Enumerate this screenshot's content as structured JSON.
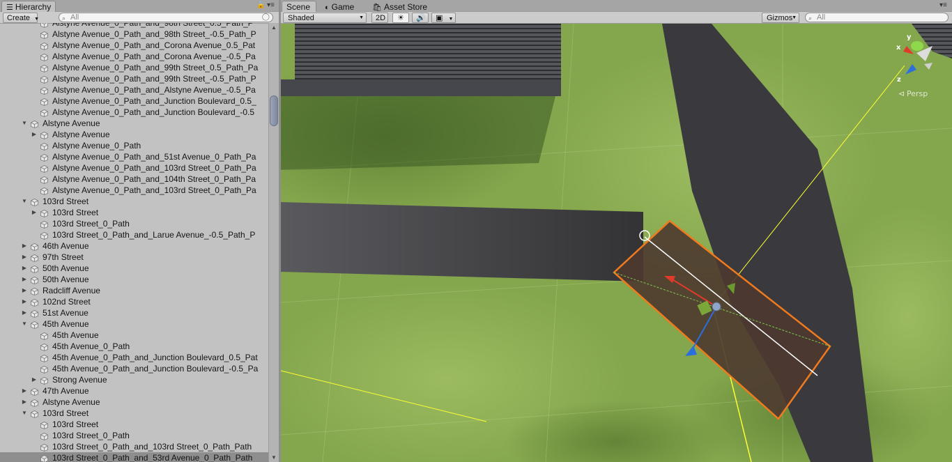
{
  "hierarchy": {
    "tab_label": "Hierarchy",
    "create_label": "Create",
    "search_placeholder": "All",
    "rows": [
      {
        "label": "Alstyne Avenue_0_Path_and_98th Street_0.5_Path_P",
        "depth": 2,
        "arrow": ""
      },
      {
        "label": "Alstyne Avenue_0_Path_and_98th Street_-0.5_Path_P",
        "depth": 2,
        "arrow": ""
      },
      {
        "label": "Alstyne Avenue_0_Path_and_Corona Avenue_0.5_Pat",
        "depth": 2,
        "arrow": ""
      },
      {
        "label": "Alstyne Avenue_0_Path_and_Corona Avenue_-0.5_Pa",
        "depth": 2,
        "arrow": ""
      },
      {
        "label": "Alstyne Avenue_0_Path_and_99th Street_0.5_Path_Pa",
        "depth": 2,
        "arrow": ""
      },
      {
        "label": "Alstyne Avenue_0_Path_and_99th Street_-0.5_Path_P",
        "depth": 2,
        "arrow": ""
      },
      {
        "label": "Alstyne Avenue_0_Path_and_Alstyne Avenue_-0.5_Pa",
        "depth": 2,
        "arrow": ""
      },
      {
        "label": "Alstyne Avenue_0_Path_and_Junction Boulevard_0.5_",
        "depth": 2,
        "arrow": ""
      },
      {
        "label": "Alstyne Avenue_0_Path_and_Junction Boulevard_-0.5",
        "depth": 2,
        "arrow": ""
      },
      {
        "label": "Alstyne Avenue",
        "depth": 1,
        "arrow": "open"
      },
      {
        "label": "Alstyne Avenue",
        "depth": 2,
        "arrow": "closed"
      },
      {
        "label": "Alstyne Avenue_0_Path",
        "depth": 2,
        "arrow": ""
      },
      {
        "label": "Alstyne Avenue_0_Path_and_51st Avenue_0_Path_Pa",
        "depth": 2,
        "arrow": ""
      },
      {
        "label": "Alstyne Avenue_0_Path_and_103rd Street_0_Path_Pa",
        "depth": 2,
        "arrow": ""
      },
      {
        "label": "Alstyne Avenue_0_Path_and_104th Street_0_Path_Pa",
        "depth": 2,
        "arrow": ""
      },
      {
        "label": "Alstyne Avenue_0_Path_and_103rd Street_0_Path_Pa",
        "depth": 2,
        "arrow": ""
      },
      {
        "label": "103rd Street",
        "depth": 1,
        "arrow": "open"
      },
      {
        "label": "103rd Street",
        "depth": 2,
        "arrow": "closed"
      },
      {
        "label": "103rd Street_0_Path",
        "depth": 2,
        "arrow": ""
      },
      {
        "label": "103rd Street_0_Path_and_Larue Avenue_-0.5_Path_P",
        "depth": 2,
        "arrow": ""
      },
      {
        "label": "46th Avenue",
        "depth": 1,
        "arrow": "closed"
      },
      {
        "label": "97th Street",
        "depth": 1,
        "arrow": "closed"
      },
      {
        "label": "50th Avenue",
        "depth": 1,
        "arrow": "closed"
      },
      {
        "label": "50th Avenue",
        "depth": 1,
        "arrow": "closed"
      },
      {
        "label": "Radcliff Avenue",
        "depth": 1,
        "arrow": "closed"
      },
      {
        "label": "102nd Street",
        "depth": 1,
        "arrow": "closed"
      },
      {
        "label": "51st Avenue",
        "depth": 1,
        "arrow": "closed"
      },
      {
        "label": "45th Avenue",
        "depth": 1,
        "arrow": "open"
      },
      {
        "label": "45th Avenue",
        "depth": 2,
        "arrow": ""
      },
      {
        "label": "45th Avenue_0_Path",
        "depth": 2,
        "arrow": ""
      },
      {
        "label": "45th Avenue_0_Path_and_Junction Boulevard_0.5_Pat",
        "depth": 2,
        "arrow": ""
      },
      {
        "label": "45th Avenue_0_Path_and_Junction Boulevard_-0.5_Pa",
        "depth": 2,
        "arrow": ""
      },
      {
        "label": "Strong Avenue",
        "depth": 2,
        "arrow": "closed"
      },
      {
        "label": "47th Avenue",
        "depth": 1,
        "arrow": "closed"
      },
      {
        "label": "Alstyne Avenue",
        "depth": 1,
        "arrow": "closed"
      },
      {
        "label": "103rd Street",
        "depth": 1,
        "arrow": "open"
      },
      {
        "label": "103rd Street",
        "depth": 2,
        "arrow": ""
      },
      {
        "label": "103rd Street_0_Path",
        "depth": 2,
        "arrow": ""
      },
      {
        "label": "103rd Street_0_Path_and_103rd Street_0_Path_Path",
        "depth": 2,
        "arrow": ""
      },
      {
        "label": "103rd Street_0_Path_and_53rd Avenue_0_Path_Path",
        "depth": 2,
        "arrow": "",
        "selected": true
      }
    ]
  },
  "scene": {
    "tabs": [
      {
        "label": "Scene",
        "icon": "scene-icon",
        "active": true
      },
      {
        "label": "Game",
        "icon": "game-icon",
        "active": false
      },
      {
        "label": "Asset Store",
        "icon": "asset-store-icon",
        "active": false
      }
    ],
    "shading_mode": "Shaded",
    "mode_2d_label": "2D",
    "gizmos_label": "Gizmos",
    "search_placeholder": "All",
    "gizmo": {
      "y_label": "y",
      "x_label": "x",
      "z_label": "z",
      "projection": "Persp"
    }
  },
  "colors": {
    "selection_outline": "#f07a1c",
    "road": "#3a3a3e",
    "grass": "#86a94f",
    "building": "#4a4b50"
  }
}
